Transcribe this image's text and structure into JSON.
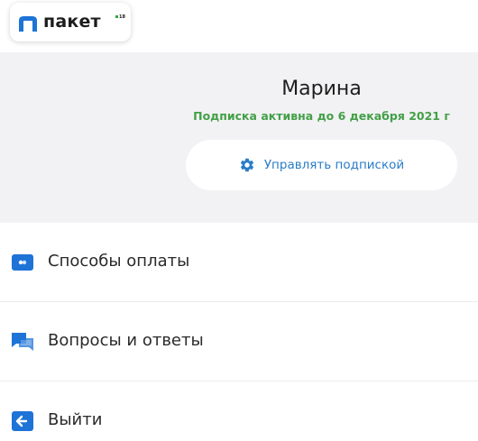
{
  "logo": {
    "text": "пакет",
    "badge": "18",
    "brand_color": "#1e73d6"
  },
  "profile": {
    "name": "Марина",
    "subscription_status": "Подписка активна до 6 декабря 2021 г",
    "status_color": "#43a047",
    "manage_button": {
      "label": "Управлять подпиской",
      "icon": "gear-icon"
    }
  },
  "menu": {
    "items": [
      {
        "label": "Способы оплаты",
        "icon": "payment-card-icon"
      },
      {
        "label": "Вопросы и ответы",
        "icon": "chat-bubbles-icon"
      },
      {
        "label": "Выйти",
        "icon": "logout-arrow-icon"
      }
    ]
  },
  "colors": {
    "accent": "#2a7cc7",
    "panel_bg": "#f2f2f4",
    "icon_blue": "#1e73d6"
  }
}
